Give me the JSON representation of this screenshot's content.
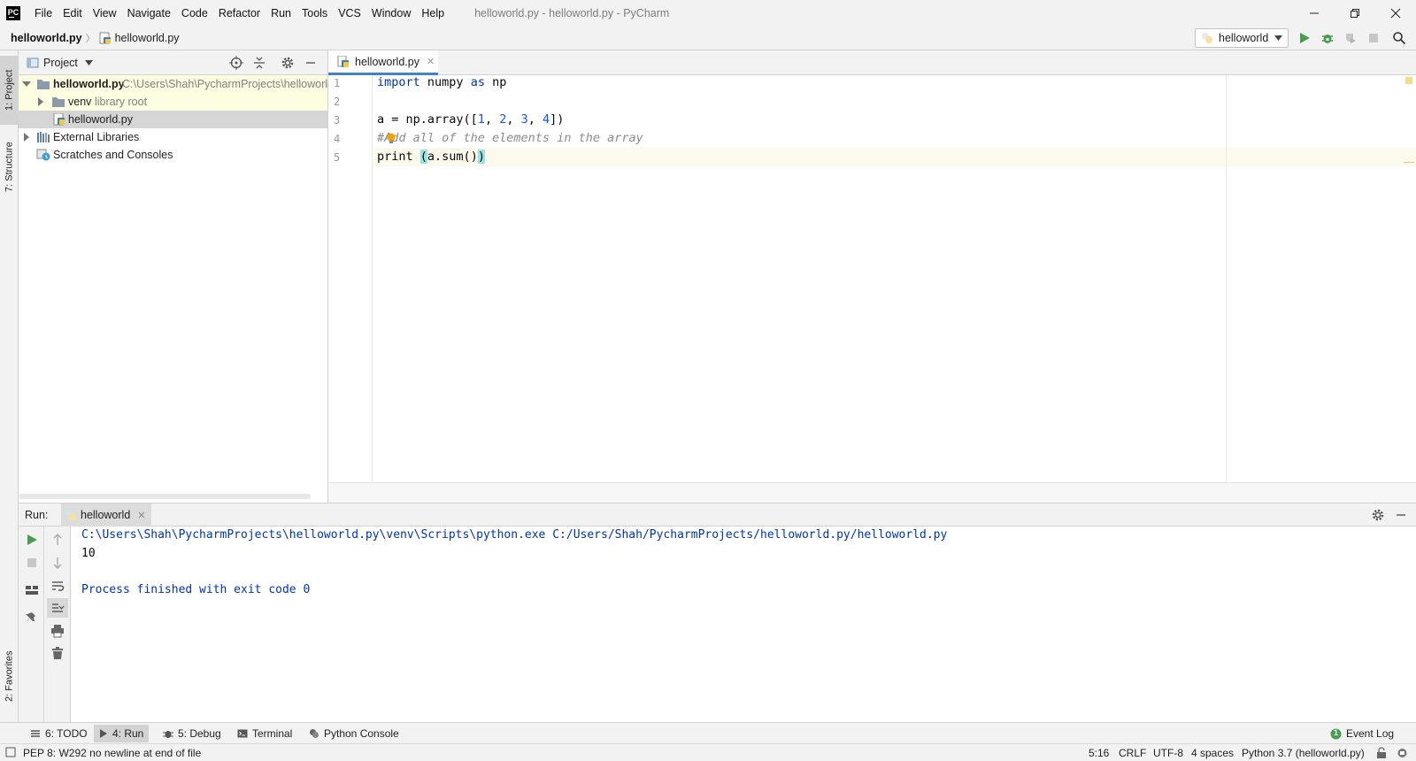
{
  "app": {
    "logo_text": "PC",
    "window_title": "helloworld.py - helloworld.py - PyCharm"
  },
  "menu": [
    {
      "label": "File"
    },
    {
      "label": "Edit"
    },
    {
      "label": "View"
    },
    {
      "label": "Navigate"
    },
    {
      "label": "Code"
    },
    {
      "label": "Refactor"
    },
    {
      "label": "Run"
    },
    {
      "label": "Tools"
    },
    {
      "label": "VCS"
    },
    {
      "label": "Window"
    },
    {
      "label": "Help"
    }
  ],
  "breadcrumb": {
    "project": "helloworld.py",
    "file": "helloworld.py"
  },
  "run_config": {
    "name": "helloworld"
  },
  "left_strip": {
    "project_tab": "1: Project",
    "structure_tab": "7: Structure",
    "favorites_tab": "2: Favorites"
  },
  "project_panel": {
    "title": "Project",
    "tree": [
      {
        "label": "helloworld.py",
        "detail": "C:\\Users\\Shah\\PycharmProjects\\helloworld"
      },
      {
        "label": "venv",
        "detail": "library root"
      },
      {
        "label": "helloworld.py",
        "detail": ""
      },
      {
        "label": "External Libraries",
        "detail": ""
      },
      {
        "label": "Scratches and Consoles",
        "detail": ""
      }
    ]
  },
  "editor": {
    "tab_label": "helloworld.py",
    "line_numbers": [
      "1",
      "2",
      "3",
      "4",
      "5"
    ],
    "lines": [
      {
        "kw": "import",
        "rest": " numpy ",
        "kw2": "as",
        "rest2": " np"
      },
      {
        "text": ""
      },
      {
        "pre": "a = np.array([",
        "n1": "1",
        "c1": ", ",
        "n2": "2",
        "c2": ", ",
        "n3": "3",
        "c3": ", ",
        "n4": "4",
        "post": "])"
      },
      {
        "comment": "#Add all of the elements in the array"
      },
      {
        "pre": "print ",
        "lparen": "(",
        "mid": "a.sum()",
        "rparen": ")"
      }
    ],
    "current_line": 5
  },
  "run_panel": {
    "label": "Run:",
    "tab_label": "helloworld",
    "console": [
      "C:\\Users\\Shah\\PycharmProjects\\helloworld.py\\venv\\Scripts\\python.exe C:/Users/Shah/PycharmProjects/helloworld.py/helloworld.py",
      "10",
      "",
      "Process finished with exit code 0"
    ]
  },
  "bottom_tabs": {
    "todo": "6: TODO",
    "run": "4: Run",
    "debug": "5: Debug",
    "terminal": "Terminal",
    "python_console": "Python Console",
    "event_log": "Event Log",
    "event_log_count": "1"
  },
  "status_bar": {
    "message": "PEP 8: W292 no newline at end of file",
    "position": "5:16",
    "line_sep": "CRLF",
    "encoding": "UTF-8",
    "indent": "4 spaces",
    "interpreter": "Python 3.7 (helloworld.py)"
  },
  "colors": {
    "accent": "#4083c9",
    "run_green": "#499c54",
    "keyword": "#0033b3",
    "number": "#1750eb",
    "comment": "#8c8c8c",
    "console_text": "#0033b3"
  }
}
